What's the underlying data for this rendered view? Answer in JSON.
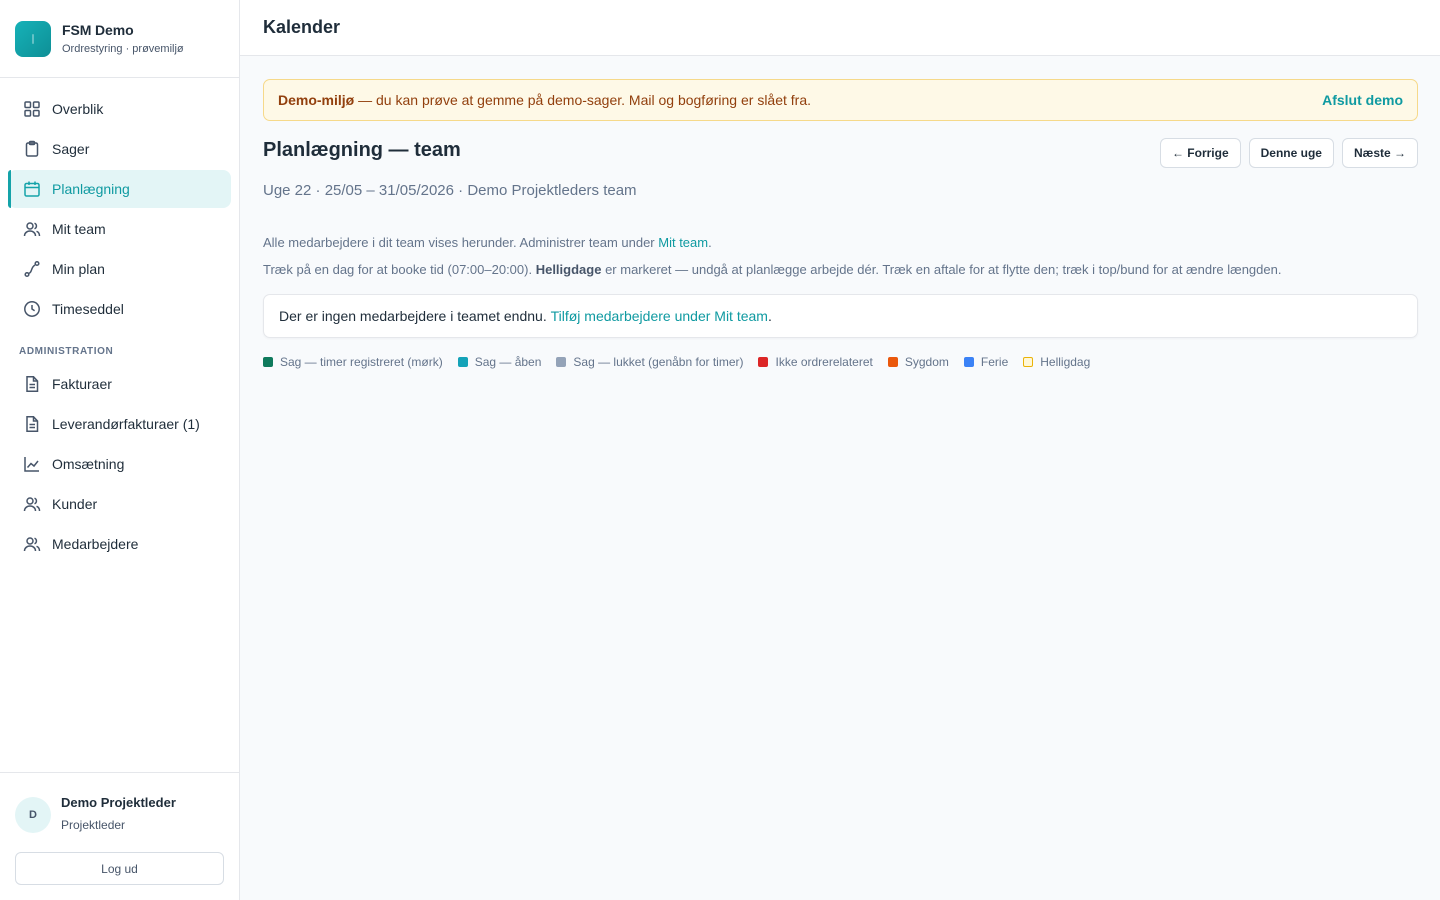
{
  "brand": {
    "name": "FSM Demo",
    "subtitle": "Ordrestyring · prøvemiljø"
  },
  "sidebar": {
    "items": [
      {
        "label": "Overblik",
        "icon": "grid-icon",
        "active": false
      },
      {
        "label": "Sager",
        "icon": "clipboard-icon",
        "active": false
      },
      {
        "label": "Planlægning",
        "icon": "calendar-icon",
        "active": true
      },
      {
        "label": "Mit team",
        "icon": "users-icon",
        "active": false
      },
      {
        "label": "Min plan",
        "icon": "route-icon",
        "active": false
      },
      {
        "label": "Timeseddel",
        "icon": "clock-icon",
        "active": false
      }
    ],
    "admin_heading": "ADMINISTRATION",
    "admin_items": [
      {
        "label": "Fakturaer",
        "icon": "document-icon"
      },
      {
        "label": "Leverandørfakturaer (1)",
        "icon": "document-icon"
      },
      {
        "label": "Omsætning",
        "icon": "line-chart-icon"
      },
      {
        "label": "Kunder",
        "icon": "users-icon"
      },
      {
        "label": "Medarbejdere",
        "icon": "users-icon"
      }
    ]
  },
  "user": {
    "initial": "D",
    "name": "Demo Projektleder",
    "role": "Projektleder",
    "logout_label": "Log ud"
  },
  "header": {
    "title": "Kalender"
  },
  "banner": {
    "bold": "Demo-miljø",
    "text": " — du kan prøve at gemme på demo-sager. Mail og bogføring er slået fra.",
    "exit_label": "Afslut demo"
  },
  "page": {
    "title": "Planlægning — team",
    "prev_label": "← Forrige",
    "this_week_label": "Denne uge",
    "next_label": "Næste →",
    "week_info": "Uge 22 · 25/05 – 31/05/2026 · Demo Projektleders team",
    "info1_text": "Alle medarbejdere i dit team vises herunder. Administrer team under ",
    "info1_link": "Mit team",
    "info1_end": ".",
    "info2_pre": "Træk på en dag for at booke tid (07:00–20:00). ",
    "info2_bold": "Helligdage",
    "info2_post": " er markeret — undgå at planlægge arbejde dér. Træk en aftale for at flytte den; træk i top/bund for at ændre længden.",
    "empty_text": "Der er ingen medarbejdere i teamet endnu. ",
    "empty_link": "Tilføj medarbejdere under Mit team",
    "empty_end": "."
  },
  "legend": [
    {
      "label": "Sag — timer registreret (mørk)",
      "color": "#0f7a5c"
    },
    {
      "label": "Sag — åben",
      "color": "#14a3b8"
    },
    {
      "label": "Sag — lukket (genåbn for timer)",
      "color": "#94a3b8"
    },
    {
      "label": "Ikke ordrerelateret",
      "color": "#dc2626"
    },
    {
      "label": "Sygdom",
      "color": "#ea580c"
    },
    {
      "label": "Ferie",
      "color": "#3b82f6"
    },
    {
      "label": "Helligdag",
      "color": "#fff7d6"
    }
  ]
}
